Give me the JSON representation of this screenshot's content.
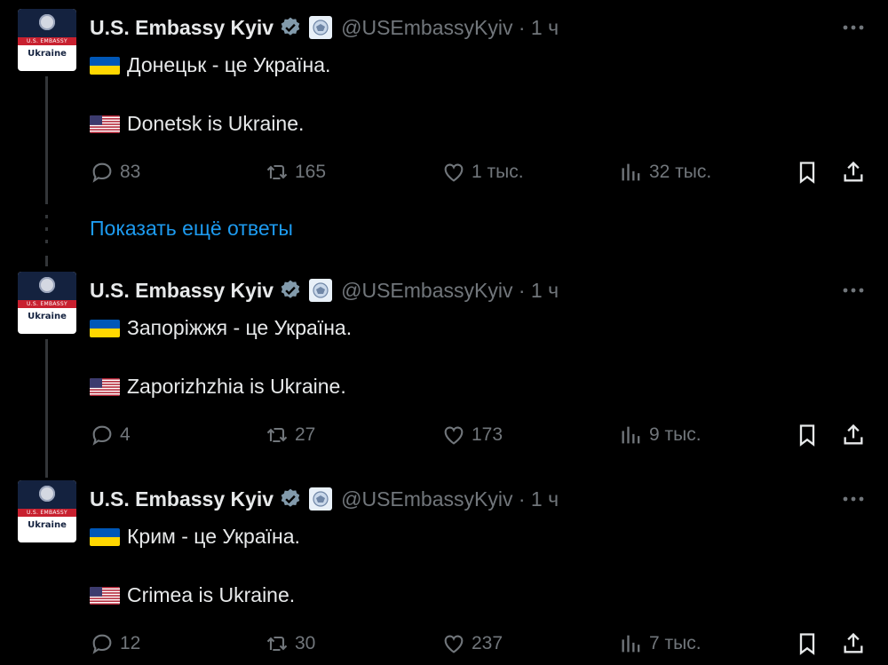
{
  "account": {
    "name": "U.S. Embassy Kyiv",
    "handle_time": "@USEmbassyKyiv · 1 ч",
    "avatar_band": "U.S. EMBASSY",
    "avatar_name": "Ukraine"
  },
  "tweets": [
    {
      "line_ua": "Донецьк - це Україна.",
      "line_en": "Donetsk is Ukraine.",
      "replies": "83",
      "reposts": "165",
      "likes": "1 тыс.",
      "views": "32 тыс."
    },
    {
      "line_ua": "Запоріжжя - це Україна.",
      "line_en": "Zaporizhzhia is Ukraine.",
      "replies": "4",
      "reposts": "27",
      "likes": "173",
      "views": "9 тыс."
    },
    {
      "line_ua": "Крим - це Україна.",
      "line_en": "Crimea is Ukraine.",
      "replies": "12",
      "reposts": "30",
      "likes": "237",
      "views": "7 тыс."
    }
  ],
  "show_more_replies": "Показать ещё ответы",
  "icons": {
    "verified": "verified-badge-icon",
    "affiliate": "embassy-seal-icon",
    "more": "more-icon",
    "reply": "reply-icon",
    "repost": "repost-icon",
    "like": "like-icon",
    "views": "views-icon",
    "bookmark": "bookmark-icon",
    "share": "share-icon",
    "flag_ua": "flag-ua-icon",
    "flag_us": "flag-us-icon"
  },
  "colors": {
    "background": "#000000",
    "text": "#e7e9ea",
    "secondary": "#71767b",
    "link": "#1d9bf0",
    "verified": "#829aab"
  }
}
